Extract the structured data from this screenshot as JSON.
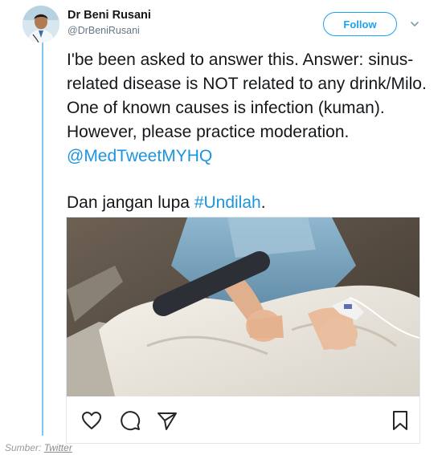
{
  "tweet": {
    "author": {
      "name": "Dr Beni Rusani",
      "handle": "@DrBeniRusani",
      "avatar_icon": "doctor-avatar"
    },
    "follow_label": "Follow",
    "menu_icon": "chevron-down-icon",
    "text": {
      "line1": "I'be been asked to answer this. Answer: sinus-related disease is NOT related to any drink/Milo. One of known causes is infection (kuman). However, please practice moderation.",
      "mention": "@MedTweetMYHQ",
      "line2_prefix": "Dan jangan lupa",
      "hashtag": "#Undilah",
      "line2_suffix": "."
    },
    "media": {
      "description_icon": "hospital-bed-photo",
      "actions": [
        "heart-icon",
        "comment-icon",
        "share-icon",
        "bookmark-icon"
      ]
    }
  },
  "source": {
    "label": "Sumber:",
    "link": "Twitter"
  },
  "colors": {
    "link": "#1b95e0",
    "follow": "#1da1f2",
    "thread_line": "#7fc6f2"
  }
}
